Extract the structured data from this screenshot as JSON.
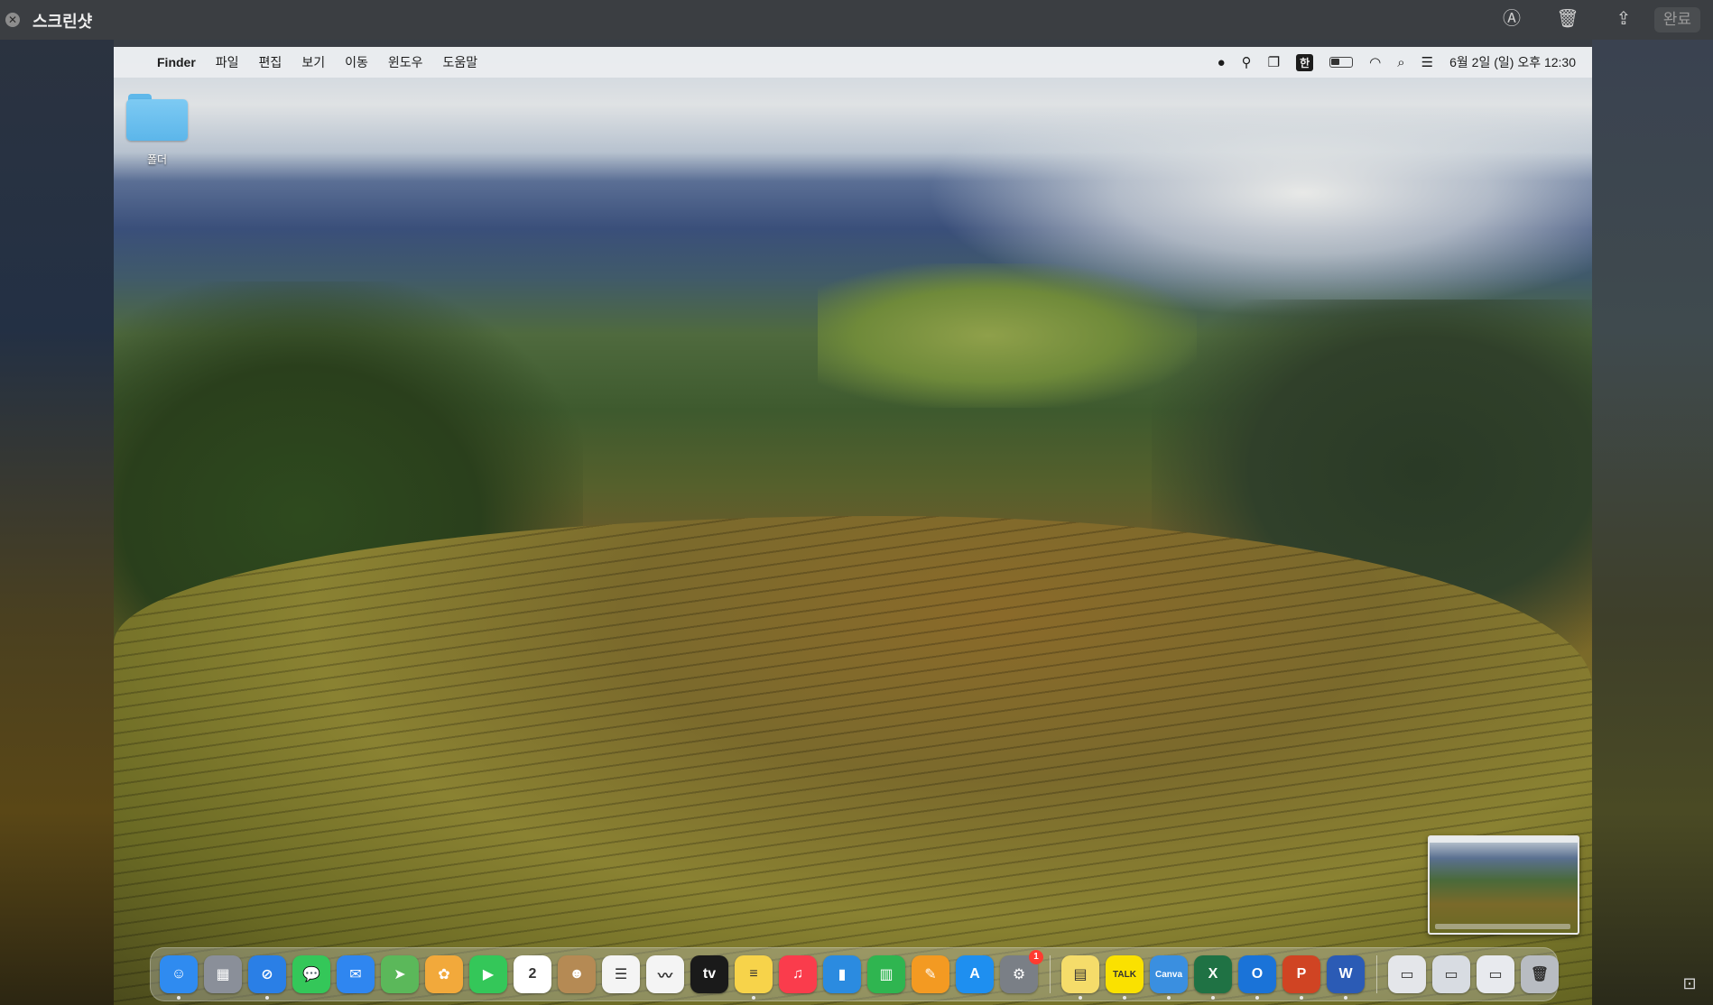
{
  "viewer": {
    "title": "스크린샷",
    "close_glyph": "✕",
    "done_label": "완료",
    "icons": [
      "markup-icon",
      "trash-icon",
      "share-icon"
    ]
  },
  "menubar": {
    "apple_glyph": "",
    "app_name": "Finder",
    "items": [
      "파일",
      "편집",
      "보기",
      "이동",
      "윈도우",
      "도움말"
    ],
    "input_method": "한",
    "battery_level": 0.45,
    "clock": "6월 2일 (일) 오후 12:30"
  },
  "desktop": {
    "folder_label": "폴더"
  },
  "dock": {
    "apps": [
      {
        "name": "Finder",
        "glyph": "☺",
        "color": "#2f8bf0",
        "running": true
      },
      {
        "name": "Launchpad",
        "glyph": "▦",
        "color": "#8a8f99",
        "running": false
      },
      {
        "name": "Safari",
        "glyph": "⊘",
        "color": "#2a7fe6",
        "running": true
      },
      {
        "name": "Messages",
        "glyph": "💬",
        "color": "#34c759",
        "running": false
      },
      {
        "name": "Mail",
        "glyph": "✉",
        "color": "#2f86f0",
        "running": false
      },
      {
        "name": "Maps",
        "glyph": "➤",
        "color": "#5bb85a",
        "running": false
      },
      {
        "name": "Photos",
        "glyph": "✿",
        "color": "#f2a93b",
        "running": false
      },
      {
        "name": "FaceTime",
        "glyph": "▶",
        "color": "#34c759",
        "running": false
      },
      {
        "name": "Calendar",
        "glyph": "2",
        "color": "#ffffff",
        "running": false
      },
      {
        "name": "Contacts",
        "glyph": "☻",
        "color": "#b58a54",
        "running": false
      },
      {
        "name": "Reminders",
        "glyph": "☰",
        "color": "#f4f4f4",
        "running": false
      },
      {
        "name": "Freeform",
        "glyph": "〰",
        "color": "#f4f4f4",
        "running": false
      },
      {
        "name": "TV",
        "glyph": "tv",
        "color": "#1a1a1a",
        "running": false
      },
      {
        "name": "Notes",
        "glyph": "≡",
        "color": "#f7d34a",
        "running": true
      },
      {
        "name": "Music",
        "glyph": "♫",
        "color": "#fa3c4c",
        "running": false
      },
      {
        "name": "Keynote",
        "glyph": "▮",
        "color": "#2b8be0",
        "running": false
      },
      {
        "name": "Numbers",
        "glyph": "▥",
        "color": "#2fb550",
        "running": false
      },
      {
        "name": "Pages",
        "glyph": "✎",
        "color": "#f39a22",
        "running": false
      },
      {
        "name": "App Store",
        "glyph": "A",
        "color": "#1e8ff0",
        "running": false
      },
      {
        "name": "System Settings",
        "glyph": "⚙",
        "color": "#7a7f86",
        "running": false,
        "badge": "1"
      }
    ],
    "apps2": [
      {
        "name": "Stickies",
        "glyph": "▤",
        "color": "#f5dc6a",
        "running": true
      },
      {
        "name": "KakaoTalk",
        "glyph": "TALK",
        "color": "#fae100",
        "running": true
      },
      {
        "name": "Canva",
        "glyph": "Canva",
        "color": "#3a8fe0",
        "running": true
      },
      {
        "name": "Excel",
        "glyph": "X",
        "color": "#1f7244",
        "running": true
      },
      {
        "name": "Outlook",
        "glyph": "O",
        "color": "#1a73d8",
        "running": true
      },
      {
        "name": "PowerPoint",
        "glyph": "P",
        "color": "#d04423",
        "running": true
      },
      {
        "name": "Word",
        "glyph": "W",
        "color": "#2b5bb5",
        "running": true
      }
    ],
    "recents": [
      {
        "name": "Recent Window 1",
        "glyph": "▭",
        "color": "#e4e6ea"
      },
      {
        "name": "Recent Window 2",
        "glyph": "▭",
        "color": "#d8dce2"
      },
      {
        "name": "Recent Window 3",
        "glyph": "▭",
        "color": "#e8eaee"
      },
      {
        "name": "Trash",
        "glyph": "🗑",
        "color": "#b8bcc2"
      }
    ]
  }
}
